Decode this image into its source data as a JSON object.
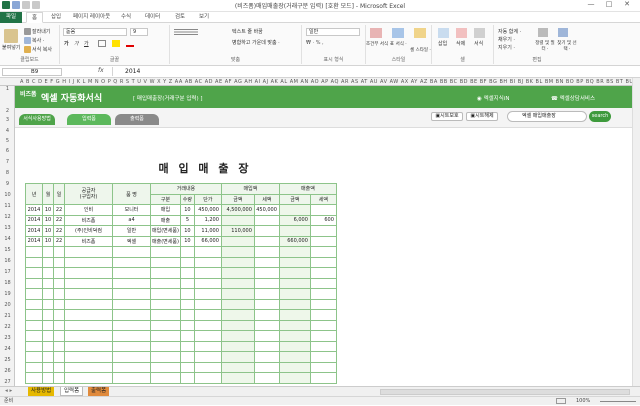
{
  "window": {
    "title": "(비즈폼)매입매출장(거래구분 입력) [호환 모드] - Microsoft Excel",
    "controls": [
      "—",
      "□",
      "✕"
    ]
  },
  "ribbon_tabs": [
    "파일",
    "홈",
    "삽입",
    "페이지 레이아웃",
    "수식",
    "데이터",
    "검토",
    "보기"
  ],
  "ribbon": {
    "clipboard": {
      "paste": "붙여넣기",
      "cut": "잘라내기",
      "copy": "복사 ·",
      "format_painter": "서식 복사",
      "label": "클립보드"
    },
    "font": {
      "name": "돋움",
      "size": "9",
      "bold": "가",
      "italic": "가",
      "underline": "가",
      "label": "글꼴"
    },
    "alignment": {
      "wrap": "텍스트 줄 바꿈",
      "merge": "병합하고 가운데 맞춤 ·",
      "label": "맞춤"
    },
    "number": {
      "format": "일반",
      "label": "표시 형식"
    },
    "styles": {
      "conditional": "조건부 서식 ·",
      "table": "표 서식 ·",
      "cell": "셀 스타일 ·",
      "label": "스타일"
    },
    "cells": {
      "insert": "삽입",
      "delete": "삭제",
      "format": "서식",
      "label": "셀"
    },
    "editing": {
      "autosum": "자동 합계 ·",
      "fill": "채우기 ·",
      "clear": "지우기 ·",
      "sort": "정렬 및 필터 ·",
      "find": "찾기 및 선택 ·",
      "label": "편집"
    }
  },
  "formula_bar": {
    "name_box": "B9",
    "fx": "fx",
    "value": "2014"
  },
  "column_headers": "A B C D E F G H I J K L M N O P Q R S T U V W X Y Z AA AB AC AD AE AF AG AH AI AJ AK AL AM AN AO AP AQ AR AS AT AU AV AW AX AY AZ BA BB BC BD BE BF BG BH BI BJ BK BL BM BN BO BP BQ BR BS BT BU BV BW BX BY BZ CA CB CC",
  "banner": {
    "logo": "비즈폼",
    "brand": "엑셀 자동화서식",
    "subtitle": "[ 매입매출장(거래구분 입력) ]",
    "right1": "엑셀지식iN",
    "right2": "엑셀상담서비스"
  },
  "nav": {
    "tabs": [
      "서식사용방법",
      "입력폼",
      "출력폼"
    ],
    "btn1": "시트보호",
    "btn2": "시트해제",
    "search_value": "엑셀 매입매출장",
    "search_btn": "search"
  },
  "document": {
    "title": "매 입 매 출 장"
  },
  "table": {
    "header_top": [
      "년",
      "월",
      "일",
      "공급자\n(구입자)",
      "품 명",
      "거래내용",
      "매입액",
      "매출액"
    ],
    "header_sub": [
      "구분",
      "수량",
      "단가",
      "금액",
      "세액",
      "금액",
      "세액"
    ],
    "rows": [
      [
        "2014",
        "10",
        "22",
        "인비",
        "모니터",
        "매입",
        "10",
        "450,000",
        "4,500,000",
        "450,000",
        "",
        ""
      ],
      [
        "2014",
        "10",
        "22",
        "비즈폼",
        "a4",
        "매출",
        "5",
        "1,200",
        "",
        "",
        "6,000",
        "600"
      ],
      [
        "2014",
        "10",
        "22",
        "(주)인비덕컴",
        "일반",
        "매입(면세품)",
        "10",
        "11,000",
        "110,000",
        "",
        "",
        ""
      ],
      [
        "2014",
        "10",
        "22",
        "비즈폼",
        "엑셀",
        "매출(면세품)",
        "10",
        "66,000",
        "",
        "",
        "660,000",
        ""
      ]
    ],
    "empty_rows": 13
  },
  "row_numbers": [
    "1",
    "2",
    "3",
    "4",
    "5",
    "6",
    "7",
    "8",
    "9",
    "10",
    "11",
    "12",
    "13",
    "14",
    "15",
    "16",
    "17",
    "18",
    "19",
    "20",
    "21",
    "22",
    "23",
    "24",
    "25",
    "26",
    "27",
    "28",
    "29"
  ],
  "sheet_tabs": [
    "사용방법",
    "입력폼",
    "출력폼"
  ],
  "status": {
    "ready": "준비",
    "zoom": "100%"
  },
  "colors": {
    "accent": "#4fa44a",
    "dark_green": "#217346",
    "tab_green": "#5cb85c",
    "tab_dark": "#7a7a7a"
  }
}
